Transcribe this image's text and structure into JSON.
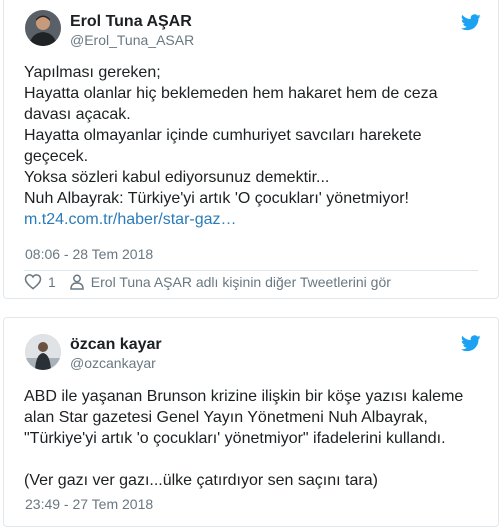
{
  "tweets": [
    {
      "author_name": "Erol Tuna AŞAR",
      "author_handle": "@Erol_Tuna_ASAR",
      "lines": [
        "Yapılması gereken;",
        "Hayatta olanlar hiç beklemeden hem hakaret hem de ceza",
        "davası açacak.",
        "Hayatta olmayanlar içinde cumhuriyet savcıları harekete",
        "geçecek.",
        "Yoksa sözleri kabul ediyorsunuz demektir...",
        "Nuh Albayrak: Türkiye'yi artık 'O çocukları' yönetmiyor!"
      ],
      "link": "m.t24.com.tr/haber/star-gaz…",
      "timestamp": "08:06 - 28 Tem 2018",
      "like_count": "1",
      "more_tweets": "Erol Tuna AŞAR adlı kişinin diğer Tweetlerini gör"
    },
    {
      "author_name": "özcan kayar",
      "author_handle": "@ozcankayar",
      "lines": [
        "ABD ile yaşanan Brunson krizine ilişkin bir köşe yazısı kaleme",
        "alan Star gazetesi Genel Yayın Yönetmeni Nuh Albayrak,",
        "\"Türkiye'yi artık 'o çocukları' yönetmiyor\" ifadelerini kullandı.",
        "",
        "(Ver gazı ver gazı...ülke çatırdıyor sen saçını tara)"
      ],
      "timestamp": "23:49 - 27 Tem 2018"
    }
  ],
  "colors": {
    "twitter_blue": "#1da1f2",
    "link": "#2b7bb9",
    "meta_gray": "#697882",
    "border": "#e1e8ed"
  },
  "icons": {
    "logo": "twitter-bird-icon",
    "like": "heart-icon",
    "profile": "person-icon"
  }
}
